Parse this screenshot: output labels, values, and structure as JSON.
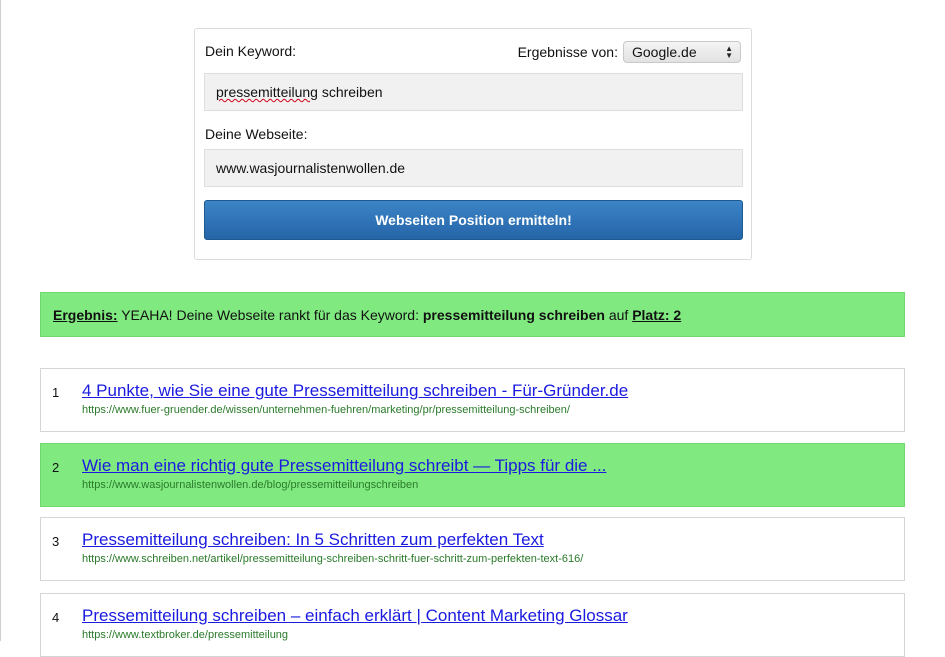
{
  "form": {
    "keyword_label": "Dein Keyword:",
    "engine_label": "Ergebnisse von:",
    "engine_value": "Google.de",
    "keyword_value_part1": "pressemitteilung",
    "keyword_value_part2": " schreiben",
    "site_label": "Deine Webseite:",
    "site_value": "www.wasjournalistenwollen.de",
    "submit_label": "Webseiten Position ermitteln!"
  },
  "result": {
    "prefix": "Ergebnis:",
    "text": " YEAHA! Deine Webseite rankt für das Keyword: ",
    "keyword": "pressemitteilung schreiben",
    "middle": " auf ",
    "rank": "Platz: 2"
  },
  "serp": [
    {
      "num": "1",
      "title": "4 Punkte, wie Sie eine gute Pressemitteilung schreiben - Für-Gründer.de",
      "url": "https://www.fuer-gruender.de/wissen/unternehmen-fuehren/marketing/pr/pressemitteilung-schreiben/",
      "highlighted": false
    },
    {
      "num": "2",
      "title": "Wie man eine richtig gute Pressemitteilung schreibt — Tipps für die ...",
      "url": "https://www.wasjournalistenwollen.de/blog/pressemitteilungschreiben",
      "highlighted": true
    },
    {
      "num": "3",
      "title": "Pressemitteilung schreiben: In 5 Schritten zum perfekten Text",
      "url": "https://www.schreiben.net/artikel/pressemitteilung-schreiben-schritt-fuer-schritt-zum-perfekten-text-616/",
      "highlighted": false
    },
    {
      "num": "4",
      "title": "Pressemitteilung schreiben – einfach erklärt | Content Marketing Glossar",
      "url": "https://www.textbroker.de/pressemitteilung",
      "highlighted": false
    }
  ],
  "colors": {
    "highlight": "#80ea80",
    "link": "#1a1ae0",
    "url": "#2a7a2a",
    "button": "#2565a8"
  }
}
